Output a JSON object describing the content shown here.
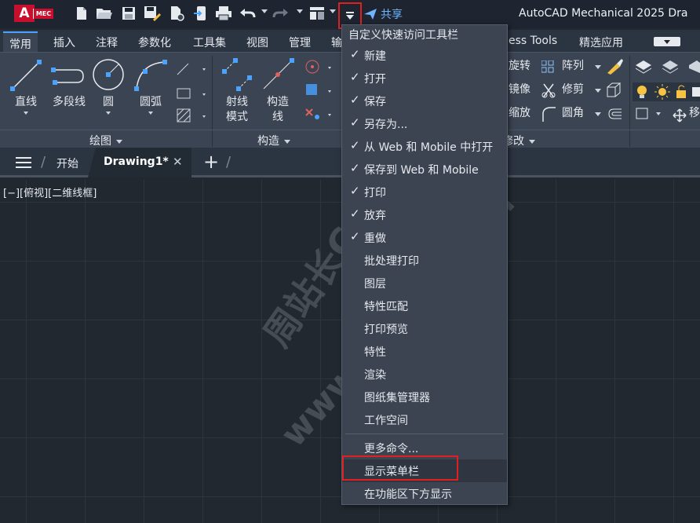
{
  "app": {
    "logo_letter": "A",
    "logo_badge": "MEC",
    "title": "AutoCAD Mechanical 2025   Dra",
    "share_label": "共享"
  },
  "ribbon_tabs": [
    "常用",
    "插入",
    "注释",
    "参数化",
    "工具集",
    "视图",
    "管理",
    "输",
    "ess Tools",
    "精选应用"
  ],
  "ribbon": {
    "draw_tools": [
      "直线",
      "多段线",
      "圆",
      "圆弧"
    ],
    "construct_tools": [
      "射线\n模式",
      "构造\n线"
    ],
    "construct_line1": "射线",
    "construct_line2": "模式",
    "construct2_line1": "构造",
    "construct2_line2": "线",
    "modify_tools": [
      "旋转",
      "阵列",
      "镜像",
      "修剪",
      "缩放",
      "圆角"
    ],
    "extra_label": "移",
    "panels": {
      "draw": "绘图",
      "construct": "构造",
      "modify": "修改"
    }
  },
  "doc_tabs": {
    "start": "开始",
    "active": "Drawing1*",
    "close": "✕",
    "add": "+"
  },
  "viewport_label": "[−][俯视][二维线框]",
  "watermark": {
    "cn": "周站长CAD",
    "url": "www.zzzcad.com"
  },
  "menu": {
    "header": "自定义快速访问工具栏",
    "items": [
      {
        "label": "新建",
        "checked": true
      },
      {
        "label": "打开",
        "checked": true
      },
      {
        "label": "保存",
        "checked": true
      },
      {
        "label": "另存为...",
        "checked": true
      },
      {
        "label": "从 Web 和 Mobile 中打开",
        "checked": true
      },
      {
        "label": "保存到 Web 和 Mobile",
        "checked": true
      },
      {
        "label": "打印",
        "checked": true
      },
      {
        "label": "放弃",
        "checked": true
      },
      {
        "label": "重做",
        "checked": true
      },
      {
        "label": "批处理打印",
        "checked": false
      },
      {
        "label": "图层",
        "checked": false
      },
      {
        "label": "特性匹配",
        "checked": false
      },
      {
        "label": "打印预览",
        "checked": false
      },
      {
        "label": "特性",
        "checked": false
      },
      {
        "label": "渲染",
        "checked": false
      },
      {
        "label": "图纸集管理器",
        "checked": false
      },
      {
        "label": "工作空间",
        "checked": false
      }
    ],
    "more": "更多命令...",
    "show_menubar": "显示菜单栏",
    "show_below": "在功能区下方显示",
    "checkmark": "✓"
  },
  "colors": {
    "highlight_border": "#e02020",
    "accent": "#4aa3ff",
    "share": "#6fb4ff"
  }
}
